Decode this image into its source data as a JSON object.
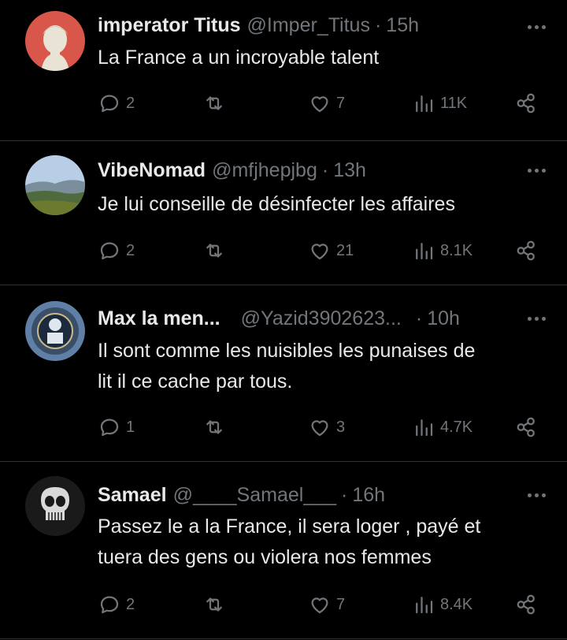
{
  "tweets": [
    {
      "name": "imperator Titus",
      "handle": "@Imper_Titus",
      "time": "15h",
      "lines": [
        "La France a un incroyable talent"
      ],
      "replies": "2",
      "reposts": "",
      "likes": "7",
      "views": "11K",
      "avatar": "roman-bust"
    },
    {
      "name": "VibeNomad",
      "handle": "@mfjhepjbg",
      "time": "13h",
      "lines": [
        "Je lui conseille de désinfecter les affaires"
      ],
      "replies": "2",
      "reposts": "",
      "likes": "21",
      "views": "8.1K",
      "avatar": "landscape"
    },
    {
      "name": "Max la men...",
      "handle": "@Yazid3902623...",
      "time": "10h",
      "lines": [
        "Il sont comme les nuisibles les punaises de",
        "lit il ce cache par tous."
      ],
      "replies": "1",
      "reposts": "",
      "likes": "3",
      "views": "4.7K",
      "avatar": "emblem"
    },
    {
      "name": "Samael",
      "handle": "@____Samael___",
      "time": "16h",
      "lines": [
        "Passez le a la France, il sera loger , payé et",
        "tuera des gens ou violera nos femmes"
      ],
      "replies": "2",
      "reposts": "",
      "likes": "7",
      "views": "8.4K",
      "avatar": "skull"
    }
  ],
  "colors": {
    "background": "#000000",
    "text": "#e7e9ea",
    "muted": "#71767b",
    "divider": "#2f3336"
  }
}
